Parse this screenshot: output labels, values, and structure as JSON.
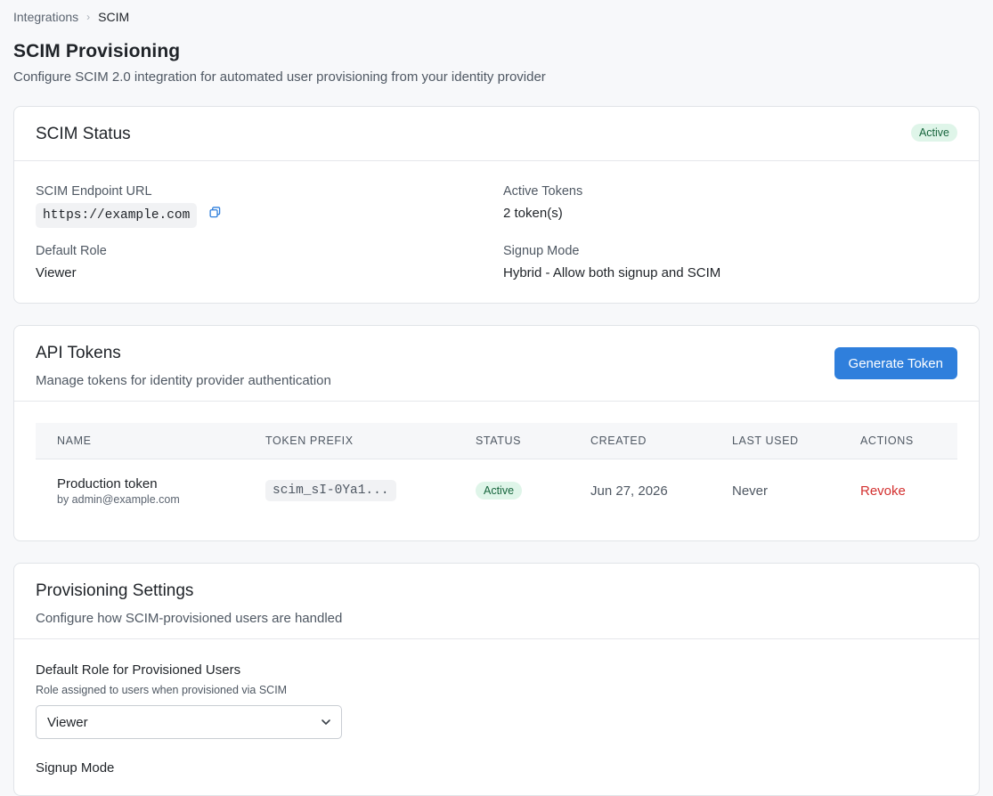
{
  "breadcrumb": {
    "parent": "Integrations",
    "separator": "›",
    "current": "SCIM"
  },
  "page": {
    "title": "SCIM Provisioning",
    "subtitle": "Configure SCIM 2.0 integration for automated user provisioning from your identity provider"
  },
  "status_card": {
    "title": "SCIM Status",
    "badge": "Active",
    "endpoint_label": "SCIM Endpoint URL",
    "endpoint_value": "https://example.com",
    "tokens_label": "Active Tokens",
    "tokens_value": "2 token(s)",
    "role_label": "Default Role",
    "role_value": "Viewer",
    "signup_label": "Signup Mode",
    "signup_value": "Hybrid - Allow both signup and SCIM"
  },
  "tokens_card": {
    "title": "API Tokens",
    "description": "Manage tokens for identity provider authentication",
    "generate_label": "Generate Token",
    "columns": [
      "NAME",
      "TOKEN PREFIX",
      "STATUS",
      "CREATED",
      "LAST USED",
      "ACTIONS"
    ],
    "rows": [
      {
        "name": "Production token",
        "by": "by admin@example.com",
        "prefix": "scim_sI-0Ya1...",
        "status": "Active",
        "created": "Jun 27, 2026",
        "last_used": "Never",
        "action": "Revoke"
      }
    ]
  },
  "settings_card": {
    "title": "Provisioning Settings",
    "description": "Configure how SCIM-provisioned users are handled",
    "role_field_label": "Default Role for Provisioned Users",
    "role_field_help": "Role assigned to users when provisioned via SCIM",
    "role_field_value": "Viewer",
    "signup_field_label": "Signup Mode"
  },
  "colors": {
    "accent": "#2f7fdc",
    "success_bg": "#dff5e9",
    "danger": "#d3302f"
  },
  "icons": {
    "copy": "copy-icon",
    "chevron": "chevron-down-icon"
  }
}
